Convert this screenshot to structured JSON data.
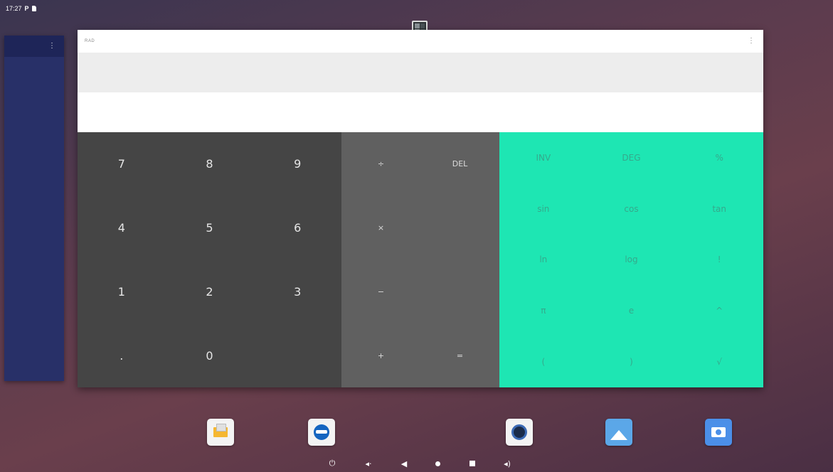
{
  "status_bar": {
    "time": "17:27",
    "notif_icon": "P"
  },
  "calculator": {
    "mode": "RAD",
    "formula": "",
    "result": "",
    "numeric": [
      "7",
      "8",
      "9",
      "4",
      "5",
      "6",
      "1",
      "2",
      "3",
      ".",
      "0",
      ""
    ],
    "operators": [
      "÷",
      "DEL",
      "×",
      "",
      "−",
      "",
      "+",
      "="
    ],
    "advanced": [
      "INV",
      "DEG",
      "%",
      "sin",
      "cos",
      "tan",
      "ln",
      "log",
      "!",
      "π",
      "e",
      "^",
      "(",
      ")",
      "√"
    ]
  },
  "dock": [
    "email-app",
    "browser-app",
    "music-app",
    "gallery-app",
    "camera-app"
  ],
  "nav": [
    "power",
    "volume-down",
    "back",
    "home",
    "recents",
    "volume-up"
  ],
  "colors": {
    "numeric_pad": "#454545",
    "operator_pad": "#606060",
    "advanced_pad": "#1ee6b3",
    "advanced_text": "#35a98c"
  }
}
